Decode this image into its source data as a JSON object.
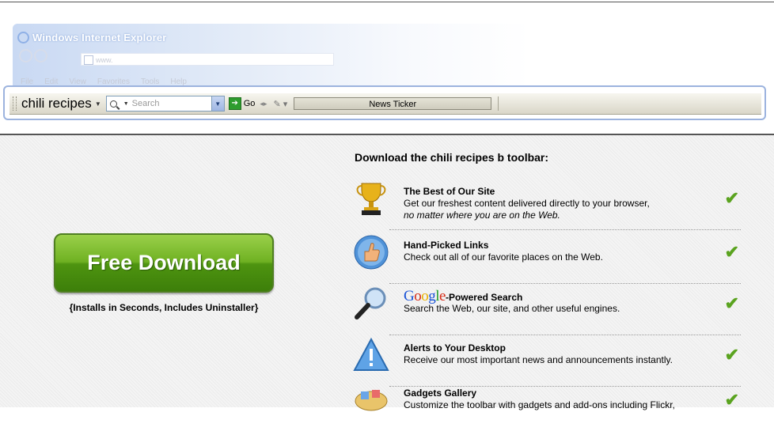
{
  "ie": {
    "title": "Windows Internet Explorer",
    "address_text": "www.",
    "menu": [
      "File",
      "Edit",
      "View",
      "Favorites",
      "Tools",
      "Help"
    ]
  },
  "toolbar": {
    "brand": "chili recipes",
    "search_placeholder": "Search",
    "go_label": "Go",
    "news_ticker": "News Ticker"
  },
  "download": {
    "button_label": "Free Download",
    "note": "{Installs in Seconds, Includes Uninstaller}"
  },
  "features": {
    "heading": "Download the chili recipes b toolbar:",
    "items": [
      {
        "title": "The Best of Our Site",
        "desc1": "Get our freshest content delivered directly to your browser,",
        "desc2": "no matter where you are on the Web.",
        "icon": "trophy-icon"
      },
      {
        "title": "Hand-Picked Links",
        "desc1": "Check out all of our favorite places on the Web.",
        "icon": "thumbs-up-icon"
      },
      {
        "title": "-Powered Search",
        "logo": "Google",
        "desc1": "Search the Web, our site, and other useful engines.",
        "icon": "magnifier-icon"
      },
      {
        "title": "Alerts to Your Desktop",
        "desc1": "Receive our most important news and announcements instantly.",
        "icon": "alert-icon"
      },
      {
        "title": "Gadgets Gallery",
        "desc1": "Customize the toolbar with gadgets and add-ons including Flickr,",
        "icon": "gadgets-icon"
      }
    ]
  },
  "colors": {
    "check": "#5aa31f",
    "button_green": "#6fb122",
    "toolbar_frame": "#9cb3de"
  }
}
